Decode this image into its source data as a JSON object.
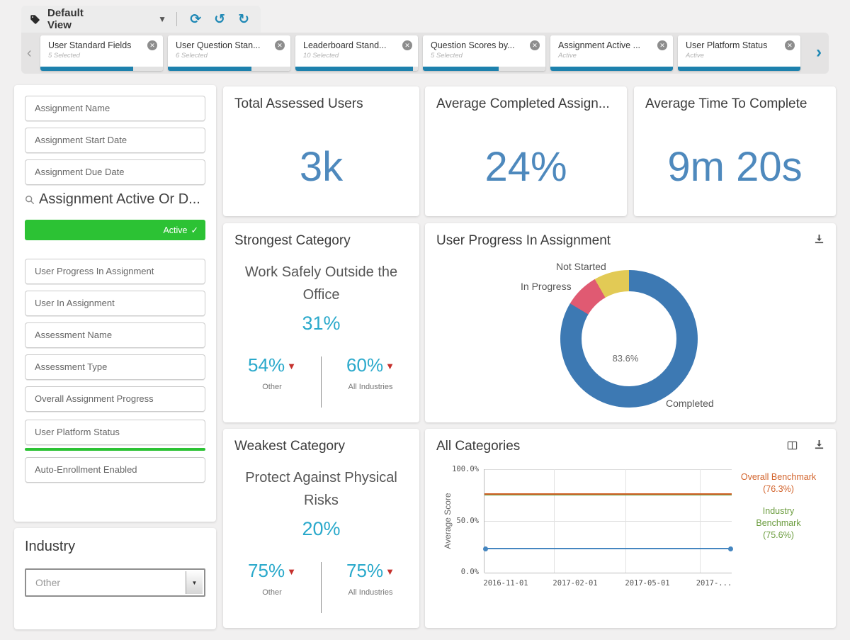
{
  "icons": {
    "refresh": "⟳",
    "undo": "↺",
    "redo": "↻",
    "caret_down": "▼",
    "chevron_left": "‹",
    "chevron_right": "›",
    "close": "✕",
    "check": "✓",
    "dropdown_arrow": "▼",
    "down_triangle": "▼"
  },
  "colors": {
    "accent_blue": "#1e88b5",
    "progress_fill": "#1d81ad",
    "kpi_blue": "#4e89bd",
    "cyan": "#2aa9cb",
    "red": "#c5302c",
    "green": "#2cc234"
  },
  "toolbar": {
    "view_label": "Default View"
  },
  "filter_chips": [
    {
      "title": "User Standard Fields",
      "subtitle": "5 Selected",
      "progress": 76
    },
    {
      "title": "User Question Stan...",
      "subtitle": "6 Selected",
      "progress": 68
    },
    {
      "title": "Leaderboard Stand...",
      "subtitle": "10 Selected",
      "progress": 96
    },
    {
      "title": "Question Scores by...",
      "subtitle": "5 Selected",
      "progress": 62
    },
    {
      "title": "Assignment Active ...",
      "subtitle": "Active",
      "progress": 100
    },
    {
      "title": "User Platform Status",
      "subtitle": "Active",
      "progress": 100
    }
  ],
  "sidebar": {
    "filters_top": [
      "Assignment Name",
      "Assignment Start Date",
      "Assignment Due Date"
    ],
    "search_value": "Assignment Active Or D...",
    "active_bar_label": "Active",
    "filters_bottom": [
      "User Progress In Assignment",
      "User In Assignment",
      "Assessment Name",
      "Assessment Type",
      "Overall Assignment Progress",
      "User Platform Status",
      "Auto-Enrollment Enabled"
    ],
    "highlighted_filter": "User Platform Status"
  },
  "industry": {
    "title": "Industry",
    "selected_option": "Other"
  },
  "kpi_cards": [
    {
      "title": "Total Assessed Users",
      "value": "3k"
    },
    {
      "title": "Average Completed Assign...",
      "value": "24%"
    },
    {
      "title": "Average Time To Complete",
      "value": "9m 20s"
    }
  ],
  "strongest_category": {
    "title": "Strongest Category",
    "name_line1": "Work Safely Outside the",
    "name_line2": "Office",
    "score": "31%",
    "comparisons": [
      {
        "value": "54%",
        "label": "Other"
      },
      {
        "value": "60%",
        "label": "All Industries"
      }
    ]
  },
  "weakest_category": {
    "title": "Weakest Category",
    "name_line1": "Protect Against Physical",
    "name_line2": "Risks",
    "score": "20%",
    "comparisons": [
      {
        "value": "75%",
        "label": "Other"
      },
      {
        "value": "75%",
        "label": "All Industries"
      }
    ]
  },
  "chart_data": [
    {
      "type": "pie",
      "donut": true,
      "title": "User Progress In Assignment",
      "slices": [
        {
          "label": "Completed",
          "value": 83.6,
          "color": "#3d79b3"
        },
        {
          "label": "In Progress",
          "value": 8.1,
          "color": "#e05a72"
        },
        {
          "label": "Not Started",
          "value": 8.3,
          "color": "#e2ca55"
        }
      ],
      "center_label": "83.6%",
      "legend_position": "around-slices"
    },
    {
      "type": "line",
      "title": "All Categories",
      "xlabel": "",
      "ylabel": "Average Score",
      "ylim": [
        0,
        100
      ],
      "grid": true,
      "yticks": [
        "100.0%",
        "50.0%",
        "0.0%"
      ],
      "xticks": [
        "2016-11-01",
        "2017-02-01",
        "2017-05-01",
        "2017-..."
      ],
      "series": [
        {
          "name": "Average Score",
          "value": 23,
          "color": "#4586c0",
          "style": "flat-line-with-endpoint-dots"
        },
        {
          "name": "Overall Benchmark",
          "value": 76.3,
          "color": "#d2622a",
          "style": "reference-line"
        },
        {
          "name": "Industry Benchmark",
          "value": 75.6,
          "color": "#6b9c3e",
          "style": "reference-line"
        }
      ],
      "legend": [
        {
          "label": "Overall Benchmark (76.3%)",
          "color": "#d2622a"
        },
        {
          "label": "Industry Benchmark (75.6%)",
          "color": "#6b9c3e"
        }
      ],
      "legend_position": "right"
    }
  ]
}
